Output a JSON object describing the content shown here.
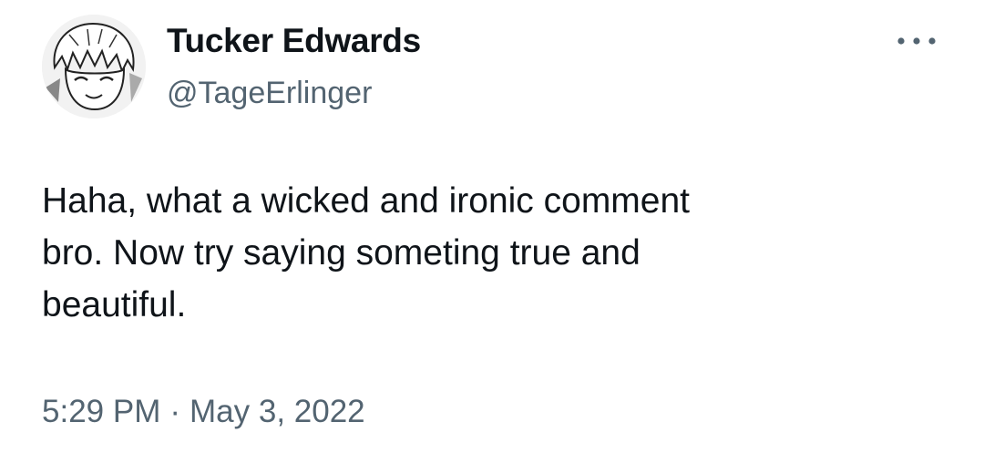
{
  "author": {
    "display_name": "Tucker Edwards",
    "handle": "@TageErlinger",
    "avatar_icon": "manga-character-avatar"
  },
  "menu": {
    "more_icon": "more-horizontal-icon"
  },
  "tweet": {
    "lines": [
      "Haha, what a wicked and ironic comment",
      "bro. Now try saying someting true and",
      "beautiful."
    ]
  },
  "meta": {
    "time": "5:29 PM",
    "separator": "·",
    "date": "May 3, 2022"
  },
  "colors": {
    "text_primary": "#0f1419",
    "text_secondary": "#536471",
    "background": "#ffffff"
  }
}
